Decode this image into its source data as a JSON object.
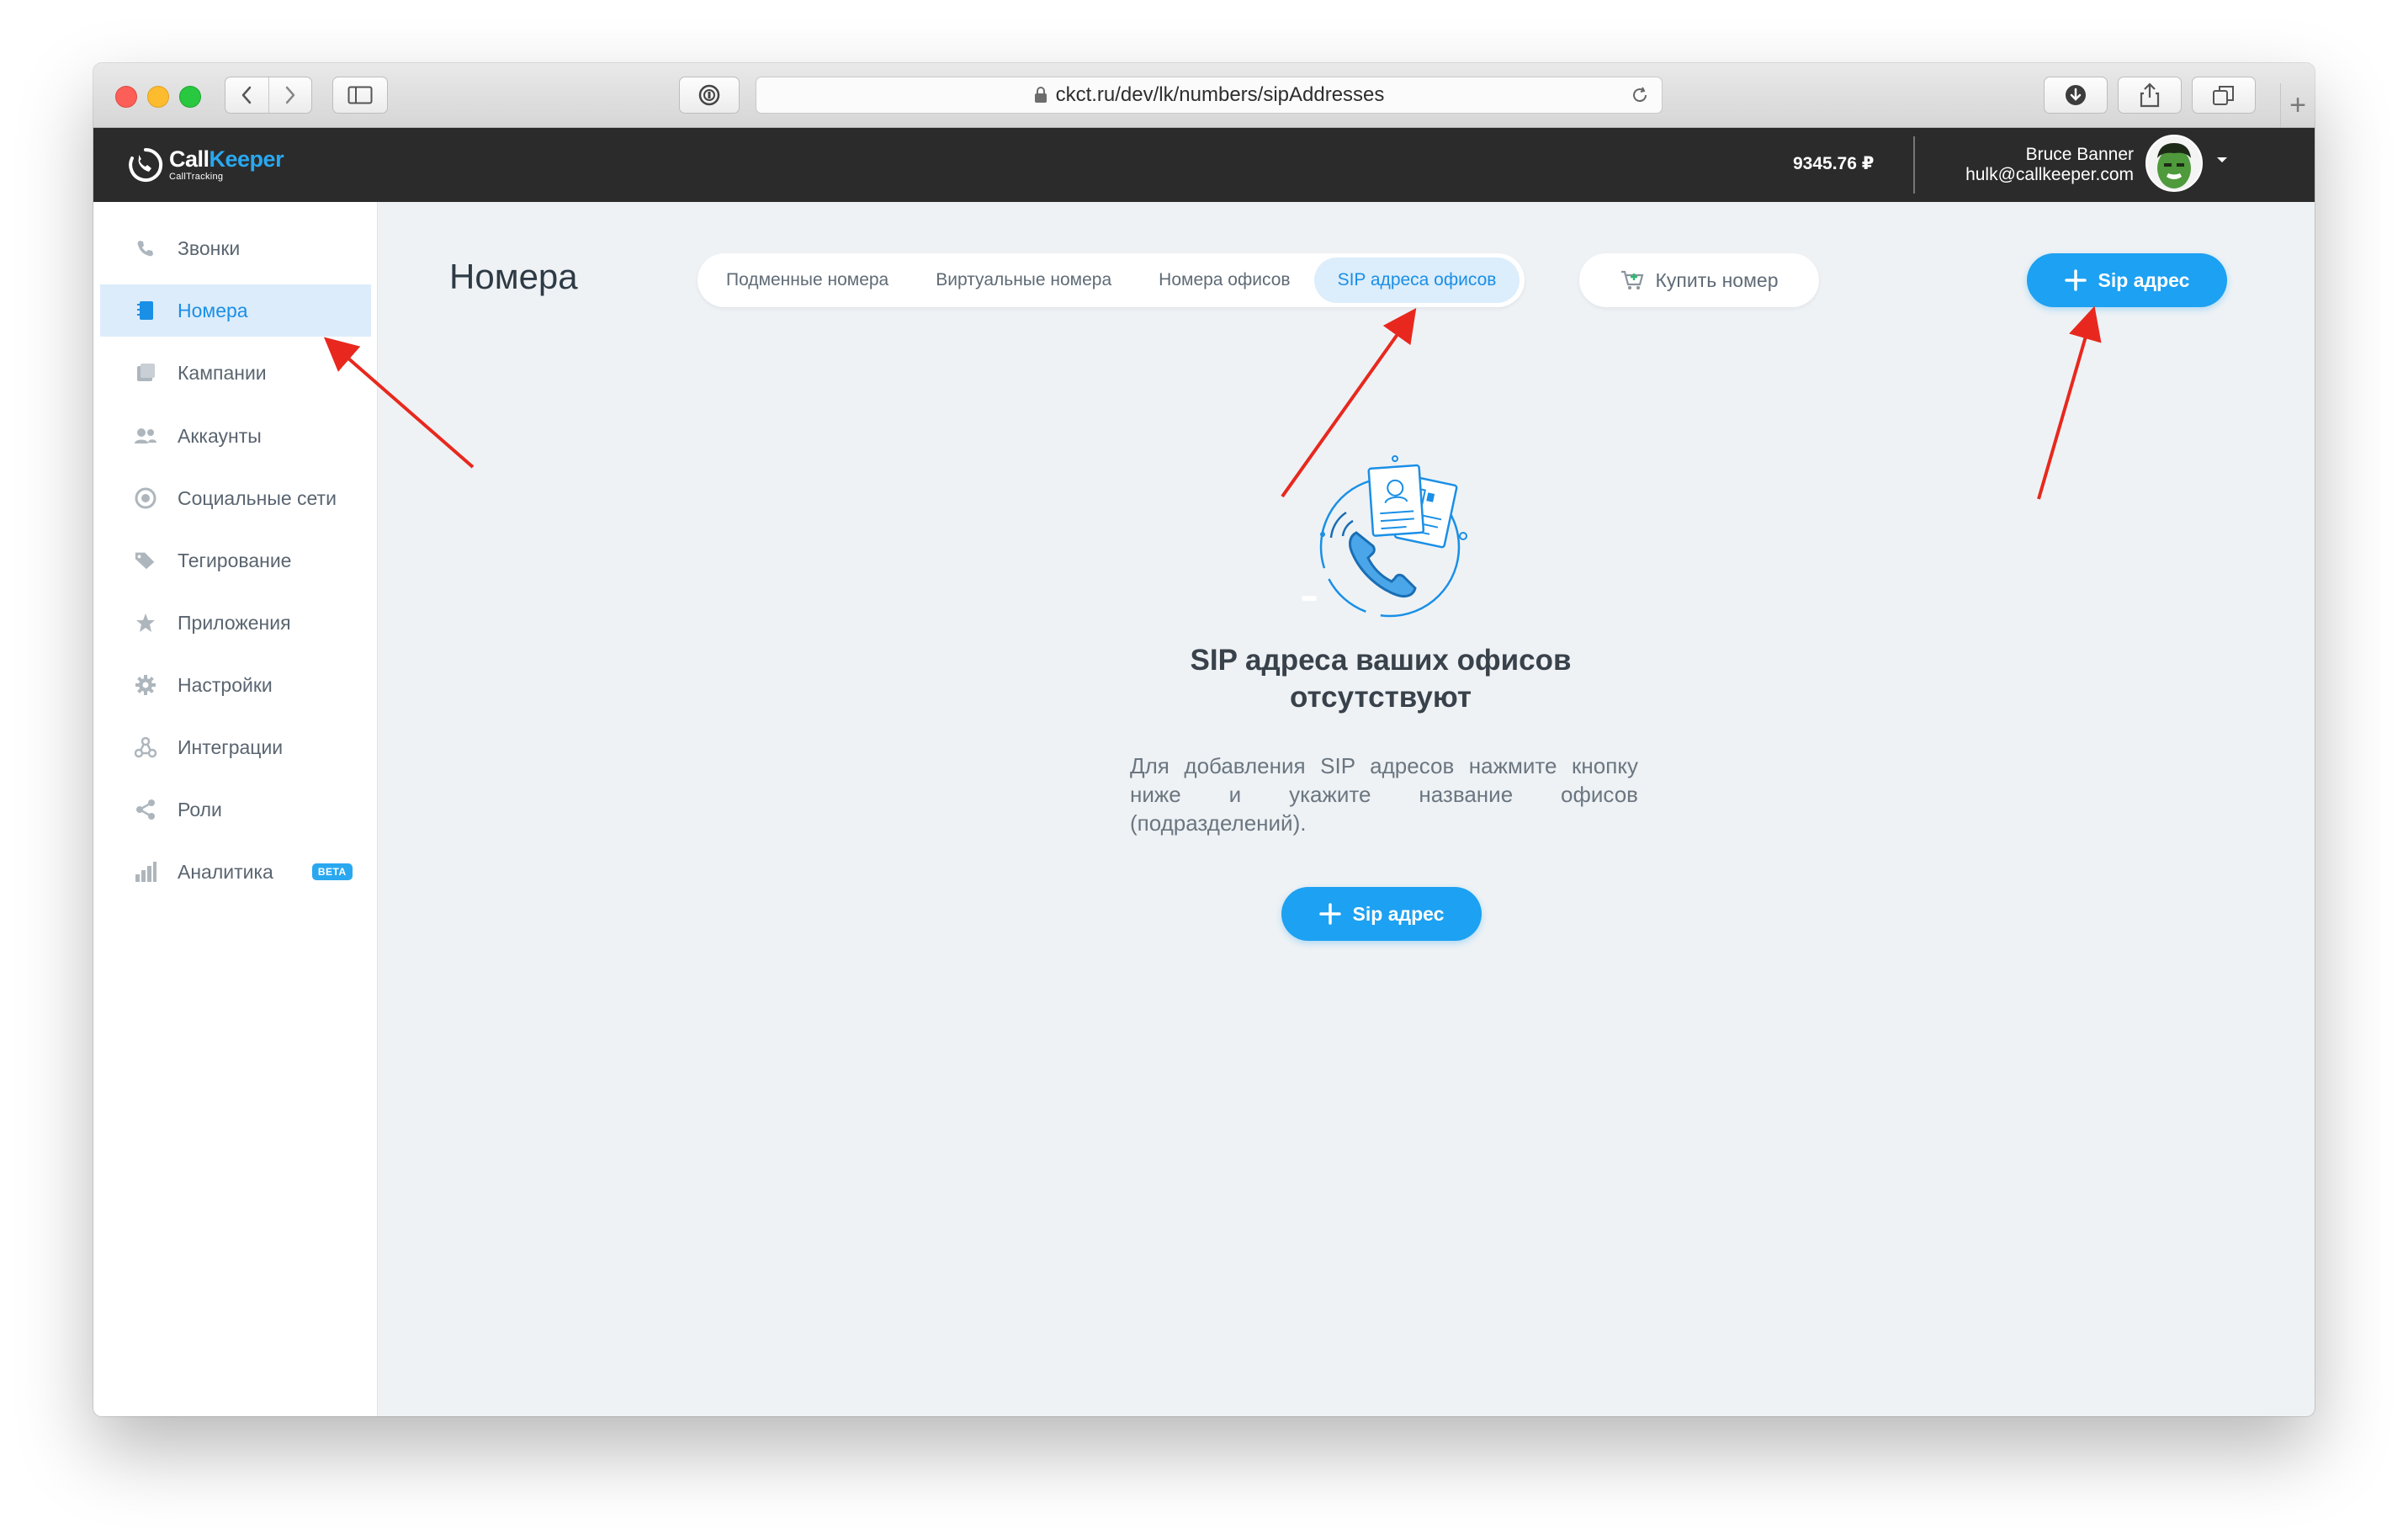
{
  "browser": {
    "url": "ckct.ru/dev/lk/numbers/sipAddresses"
  },
  "header": {
    "logo_main": "Call",
    "logo_accent": "Keeper",
    "logo_sub": "CallTracking",
    "balance": "9345.76 ₽",
    "user_name": "Bruce Banner",
    "user_email": "hulk@callkeeper.com"
  },
  "sidebar": {
    "items": [
      {
        "label": "Звонки",
        "icon": "phone-icon",
        "active": false
      },
      {
        "label": "Номера",
        "icon": "numbers-book-icon",
        "active": true
      },
      {
        "label": "Кампании",
        "icon": "campaigns-icon",
        "active": false
      },
      {
        "label": "Аккаунты",
        "icon": "users-icon",
        "active": false
      },
      {
        "label": "Социальные сети",
        "icon": "globe-icon",
        "active": false
      },
      {
        "label": "Тегирование",
        "icon": "tags-icon",
        "active": false
      },
      {
        "label": "Приложения",
        "icon": "star-apps-icon",
        "active": false
      },
      {
        "label": "Настройки",
        "icon": "gear-icon",
        "active": false
      },
      {
        "label": "Интеграции",
        "icon": "integrations-icon",
        "active": false
      },
      {
        "label": "Роли",
        "icon": "share-roles-icon",
        "active": false
      },
      {
        "label": "Аналитика",
        "icon": "bar-chart-icon",
        "active": false,
        "badge": "BETA"
      }
    ]
  },
  "main": {
    "title": "Номера",
    "tabs": [
      {
        "label": "Подменные номера",
        "active": false
      },
      {
        "label": "Виртуальные номера",
        "active": false
      },
      {
        "label": "Номера офисов",
        "active": false
      },
      {
        "label": "SIP адреса офисов",
        "active": true
      }
    ],
    "buy_label": "Купить номер",
    "add_sip_label": "Sip адрес",
    "empty_title": "SIP адреса ваших офисов отсутствуют",
    "empty_description": "Для добавления SIP адресов нажмите кнопку ниже и укажите название офисов (подразделений).",
    "add_sip_center_label": "Sip адрес"
  },
  "colors": {
    "accent": "#1da1f2",
    "header_bg": "#2b2b2b",
    "active_bg": "#dcecfa",
    "annotation_arrow": "#e8281e"
  }
}
